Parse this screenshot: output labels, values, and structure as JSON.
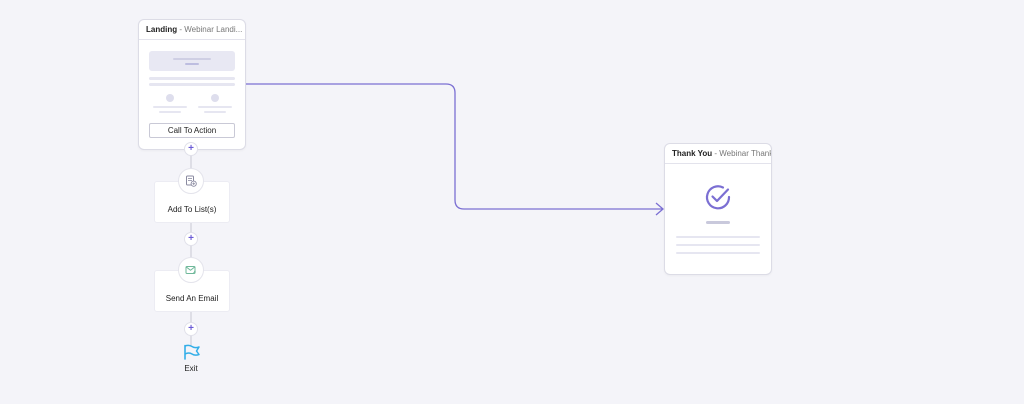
{
  "landing": {
    "title": "Landing",
    "separator": " - ",
    "subtitle": "Webinar Landi...",
    "cta_label": "Call To Action"
  },
  "thank_you": {
    "title": "Thank You",
    "separator": " - ",
    "subtitle": "Webinar Thank..."
  },
  "steps": [
    {
      "label": "Add To List(s)",
      "icon": "list-add-icon"
    },
    {
      "label": "Send An Email",
      "icon": "email-icon"
    }
  ],
  "add_step_symbol": "+",
  "exit": {
    "label": "Exit",
    "icon": "flag-icon"
  },
  "colors": {
    "accent": "#7b6fd3",
    "connector_gray": "#c8c8d4",
    "flag": "#33aee8",
    "email_icon": "#6fb89a"
  }
}
